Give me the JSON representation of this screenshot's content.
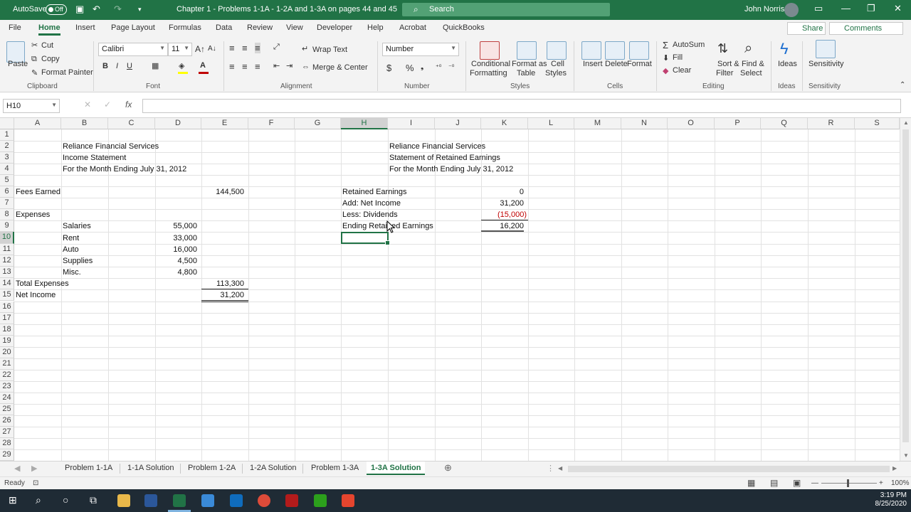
{
  "titlebar": {
    "autosave_label": "AutoSave",
    "autosave_state": "Off",
    "document_title": "Chapter 1 - Problems 1-1A - 1-2A and 1-3A on pages 44 and 45",
    "search_placeholder": "Search",
    "user_name": "John Norris"
  },
  "ribbon_tabs": [
    "File",
    "Home",
    "Insert",
    "Page Layout",
    "Formulas",
    "Data",
    "Review",
    "View",
    "Developer",
    "Help",
    "Acrobat",
    "QuickBooks"
  ],
  "share_label": "Share",
  "comments_label": "Comments",
  "ribbon": {
    "clipboard": {
      "paste": "Paste",
      "cut": "Cut",
      "copy": "Copy",
      "format_painter": "Format Painter",
      "group": "Clipboard"
    },
    "font": {
      "name": "Calibri",
      "size": "11",
      "bold": "B",
      "italic": "I",
      "underline": "U",
      "group": "Font"
    },
    "alignment": {
      "wrap_text": "Wrap Text",
      "merge_center": "Merge & Center",
      "group": "Alignment"
    },
    "number": {
      "format": "Number",
      "currency": "$",
      "percent": "%",
      "group": "Number"
    },
    "styles": {
      "conditional": "Conditional",
      "conditional2": "Formatting",
      "format_as": "Format as",
      "format_as2": "Table",
      "cell": "Cell",
      "cell2": "Styles",
      "group": "Styles"
    },
    "cells": {
      "insert": "Insert",
      "delete": "Delete",
      "format": "Format",
      "group": "Cells"
    },
    "editing": {
      "autosum": "AutoSum",
      "fill": "Fill",
      "clear": "Clear",
      "sort": "Sort &",
      "sort2": "Filter",
      "find": "Find &",
      "find2": "Select",
      "group": "Editing"
    },
    "ideas": {
      "label": "Ideas",
      "group": "Ideas"
    },
    "sensitivity": {
      "label": "Sensitivity",
      "group": "Sensitivity"
    }
  },
  "formula_bar": {
    "name_box": "H10",
    "fx": "fx",
    "formula": ""
  },
  "columns": [
    "A",
    "B",
    "C",
    "D",
    "E",
    "F",
    "G",
    "H",
    "I",
    "J",
    "K",
    "L",
    "M",
    "N",
    "O",
    "P",
    "Q",
    "R",
    "S"
  ],
  "rows": [
    "1",
    "2",
    "3",
    "4",
    "5",
    "6",
    "7",
    "8",
    "9",
    "10",
    "11",
    "12",
    "13",
    "14",
    "15",
    "16",
    "17",
    "18",
    "19",
    "20",
    "21",
    "22",
    "23",
    "24",
    "25",
    "26",
    "27",
    "28",
    "29"
  ],
  "income": {
    "company": "Reliance Financial Services",
    "statement": "Income Statement",
    "period": "For the Month Ending July 31, 2012",
    "fees_label": "Fees Earned",
    "fees_value": "144,500",
    "expenses_label": "Expenses",
    "salaries_label": "Salaries",
    "salaries_value": "55,000",
    "rent_label": "Rent",
    "rent_value": "33,000",
    "auto_label": "Auto",
    "auto_value": "16,000",
    "supplies_label": "Supplies",
    "supplies_value": "4,500",
    "misc_label": "Misc.",
    "misc_value": "4,800",
    "total_label": "Total Expenses",
    "total_value": "113,300",
    "net_label": "Net Income",
    "net_value": "31,200"
  },
  "retained": {
    "company": "Reliance Financial Services",
    "statement": "Statement of Retained Earnings",
    "period": "For the Month Ending July 31, 2012",
    "re_label": "Retained Earnings",
    "re_value": "0",
    "add_label": "Add: Net Income",
    "add_value": "31,200",
    "less_label": "Less: Dividends",
    "less_value": "(15,000)",
    "end_label": "Ending Retained Earnings",
    "end_value": "16,200"
  },
  "sheet_tabs": [
    "Problem 1-1A",
    "1-1A Solution",
    "Problem 1-2A",
    "1-2A Solution",
    "Problem 1-3A",
    "1-3A Solution"
  ],
  "status": {
    "ready": "Ready",
    "zoom": "100%"
  },
  "taskbar": {
    "time": "3:19 PM",
    "date": "8/25/2020"
  }
}
